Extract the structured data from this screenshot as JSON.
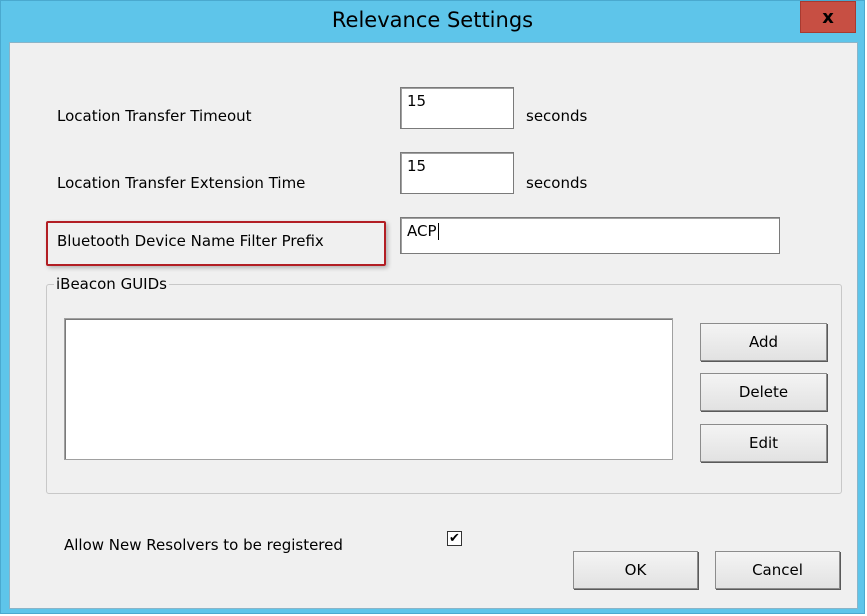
{
  "window": {
    "title": "Relevance Settings",
    "close_label": "x"
  },
  "form": {
    "timeout_label": "Location Transfer Timeout",
    "timeout_value": "15",
    "timeout_unit": "seconds",
    "extension_label": "Location Transfer Extension Time",
    "extension_value": "15",
    "extension_unit": "seconds",
    "filter_label": "Bluetooth Device Name Filter Prefix",
    "filter_value": "ACP"
  },
  "ibeacon": {
    "group_title": "iBeacon GUIDs",
    "items": [],
    "add_label": "Add",
    "delete_label": "Delete",
    "edit_label": "Edit"
  },
  "resolvers": {
    "label": "Allow New Resolvers to be registered",
    "checked": true,
    "check_mark": "✔"
  },
  "footer": {
    "ok_label": "OK",
    "cancel_label": "Cancel"
  },
  "colors": {
    "titlebar": "#5ec5ea",
    "close_button": "#c74f43",
    "highlight": "#b21e24"
  }
}
